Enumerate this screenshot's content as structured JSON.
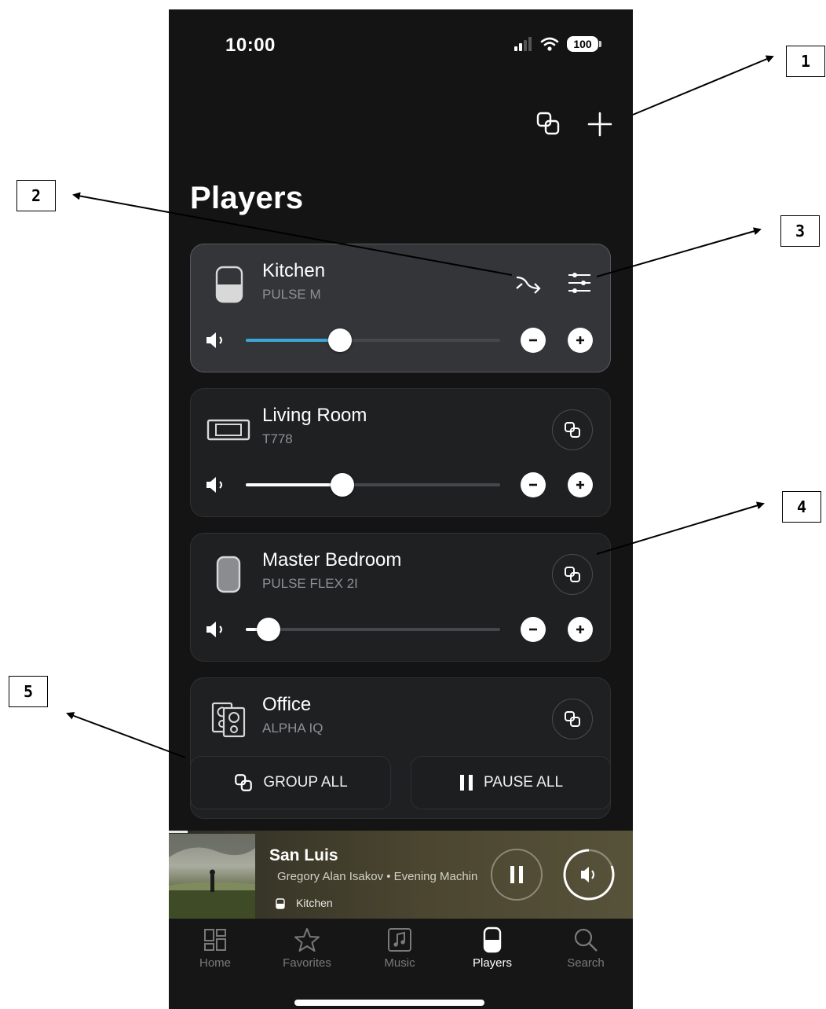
{
  "status_bar": {
    "time": "10:00",
    "battery": "100"
  },
  "header": {
    "group_icon": "group-rooms-icon",
    "add_icon": "plus-icon",
    "title": "Players"
  },
  "players": [
    {
      "name": "Kitchen",
      "model": "PULSE M",
      "device_icon": "pulse-m-speaker-icon",
      "volume": 0.37,
      "active": true,
      "accent": "#3aa7d6",
      "actions": [
        "route-arrow-icon",
        "settings-sliders-icon"
      ]
    },
    {
      "name": "Living Room",
      "model": "T778",
      "device_icon": "soundbar-icon",
      "volume": 0.38,
      "active": false,
      "actions": [
        "group-icon"
      ]
    },
    {
      "name": "Master Bedroom",
      "model": "PULSE FLEX 2I",
      "device_icon": "pulse-flex-speaker-icon",
      "volume": 0.09,
      "active": false,
      "actions": [
        "group-icon"
      ]
    },
    {
      "name": "Office",
      "model": "ALPHA IQ",
      "device_icon": "stereo-speakers-icon",
      "active": false,
      "actions": [
        "group-icon"
      ]
    }
  ],
  "bulk_actions": {
    "group_all": "GROUP ALL",
    "pause_all": "PAUSE ALL"
  },
  "now_playing": {
    "title": "San Luis",
    "subtitle": "Gregory Alan Isakov • Evening Machin",
    "room": "Kitchen",
    "progress": 0.04
  },
  "tabs": [
    {
      "label": "Home",
      "icon": "home-grid-icon",
      "active": false
    },
    {
      "label": "Favorites",
      "icon": "star-icon",
      "active": false
    },
    {
      "label": "Music",
      "icon": "music-note-icon",
      "active": false
    },
    {
      "label": "Players",
      "icon": "speaker-icon",
      "active": true
    },
    {
      "label": "Search",
      "icon": "search-icon",
      "active": false
    }
  ],
  "callouts": [
    "1",
    "2",
    "3",
    "4",
    "5"
  ],
  "colors": {
    "background": "#141414",
    "card": "#1f2022",
    "card_active": "#333539",
    "accent": "#3aa7d6"
  }
}
